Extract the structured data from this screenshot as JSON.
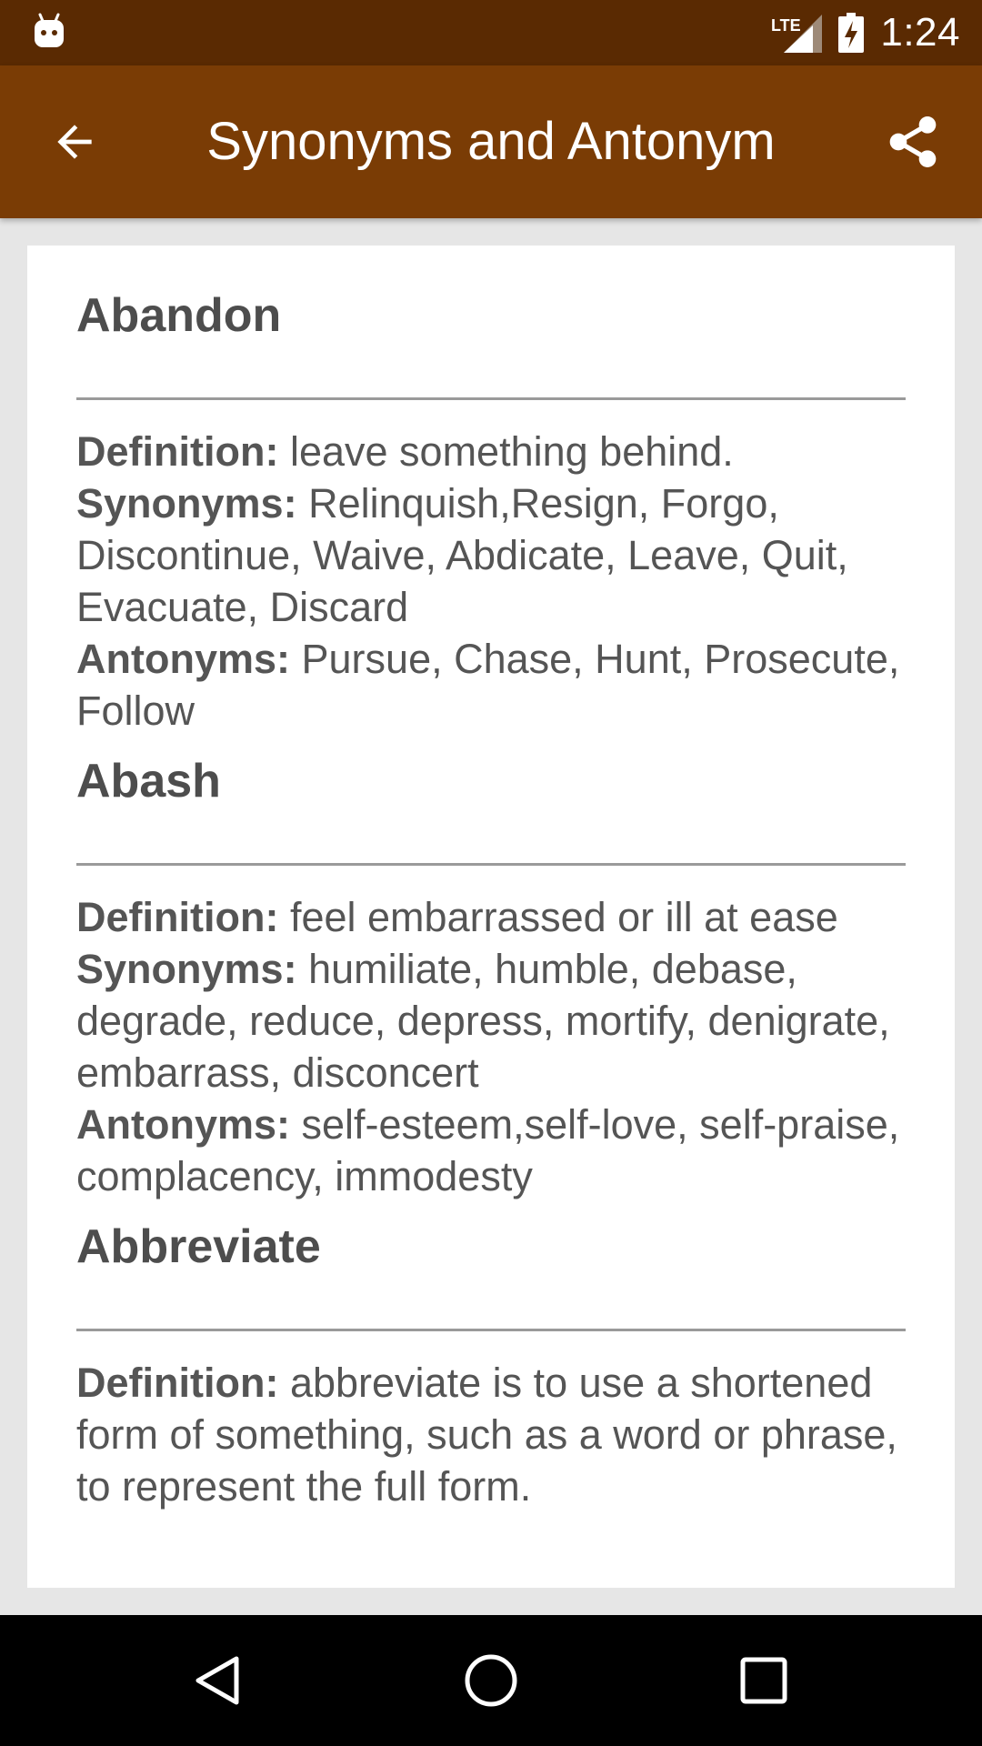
{
  "status_bar": {
    "time": "1:24",
    "network": "LTE",
    "icons": [
      "android-notification-icon",
      "lte-signal-icon",
      "battery-charging-icon"
    ]
  },
  "app_bar": {
    "title": "Synonyms and Antonym",
    "back_icon": "arrow-back-icon",
    "share_icon": "share-icon",
    "color": "#7a3c05",
    "status_color": "#5a2a02"
  },
  "labels": {
    "definition": "Definition:",
    "synonyms": "Synonyms:",
    "antonyms": "Antonyms:"
  },
  "entries": [
    {
      "word": "Abandon",
      "definition": "leave something behind.",
      "synonyms": "Relinquish,Resign, Forgo, Discontinue, Waive, Abdicate, Leave, Quit, Evacuate, Discard",
      "antonyms": "Pursue, Chase, Hunt, Prosecute, Follow"
    },
    {
      "word": "Abash",
      "definition": "feel embarrassed or ill at ease",
      "synonyms": "humiliate, humble, debase, degrade, reduce, depress, mortify, denigrate, embarrass, disconcert",
      "antonyms": "self-esteem,self-love, self-praise, complacency, immodesty"
    },
    {
      "word": "Abbreviate",
      "definition": "abbreviate is to use a shortened form of something, such as a word or phrase, to represent the full form."
    }
  ],
  "nav_bar": {
    "buttons": [
      "back-triangle-icon",
      "home-circle-icon",
      "recents-square-icon"
    ]
  }
}
